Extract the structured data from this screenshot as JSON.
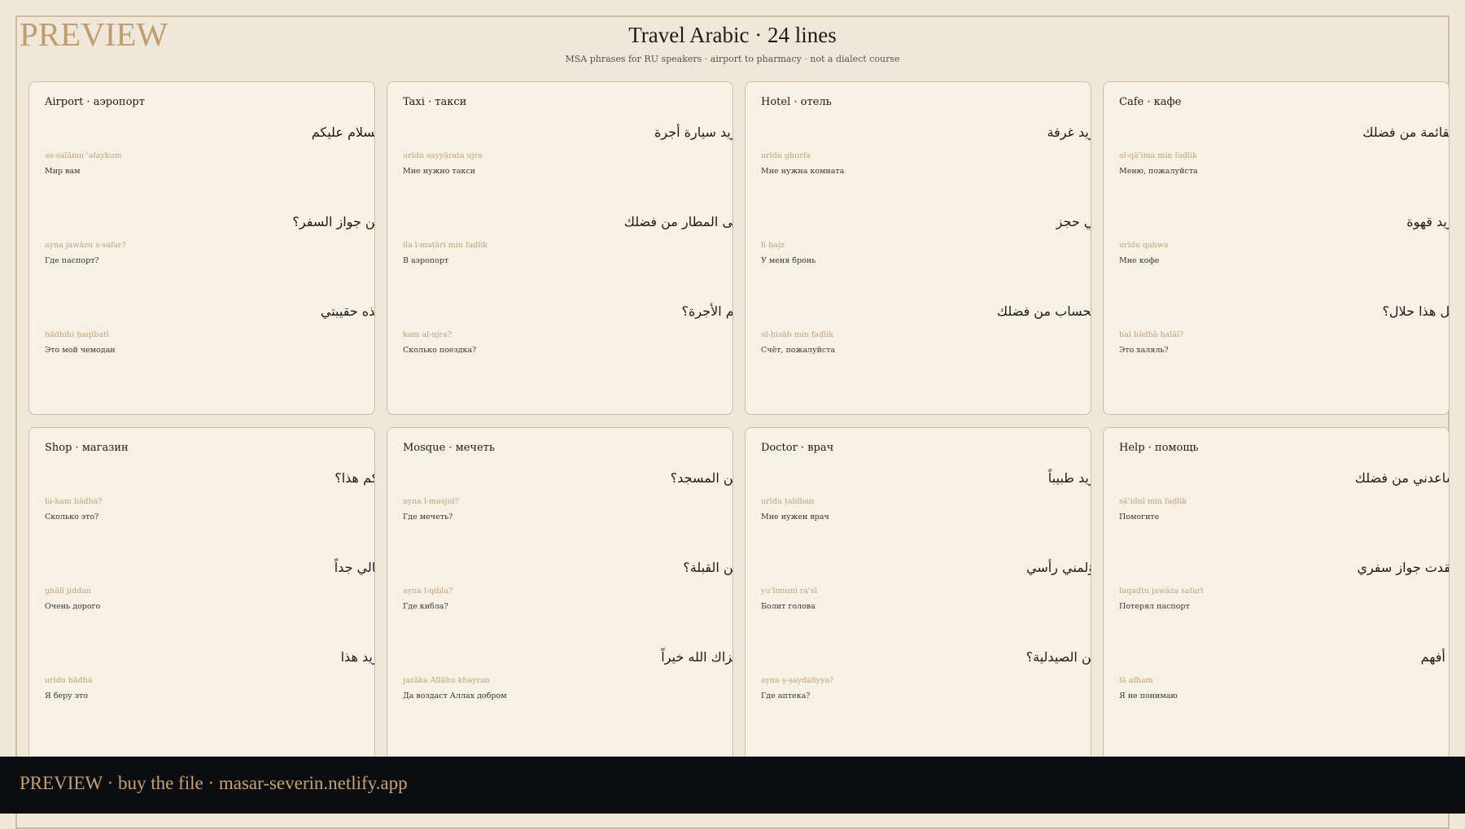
{
  "watermark": "PREVIEW",
  "title": "Travel Arabic · 24 lines",
  "subtitle": "MSA phrases for RU speakers · airport to pharmacy · not a dialect course",
  "cards": [
    {
      "title": "Airport · аэропорт",
      "phrases": [
        {
          "arabic": "السلام عليكم",
          "translit": "as-salāmu ʿalaykum",
          "russian": "Мир вам"
        },
        {
          "arabic": "أين جواز السفر؟",
          "translit": "ayna jawāzu s-safar?",
          "russian": "Где паспорт?"
        },
        {
          "arabic": "هذه حقيبتي",
          "translit": "hādhihi ḥaqībatī",
          "russian": "Это мой чемодан"
        }
      ]
    },
    {
      "title": "Taxi · такси",
      "phrases": [
        {
          "arabic": "أريد سيارة أجرة",
          "translit": "urīdu sayyārata ujra",
          "russian": "Мне нужно такси"
        },
        {
          "arabic": "إلى المطار من فضلك",
          "translit": "ila l-maṭāri min faḍlik",
          "russian": "В аэропорт"
        },
        {
          "arabic": "كم الأجرة؟",
          "translit": "kam al-ujra?",
          "russian": "Сколько поездка?"
        }
      ]
    },
    {
      "title": "Hotel · отель",
      "phrases": [
        {
          "arabic": "أريد غرفة",
          "translit": "urīdu ghurfa",
          "russian": "Мне нужна комната"
        },
        {
          "arabic": "لي حجز",
          "translit": "lī ḥajz",
          "russian": "У меня бронь"
        },
        {
          "arabic": "الحساب من فضلك",
          "translit": "al-ḥisāb min faḍlik",
          "russian": "Счёт, пожалуйста"
        }
      ]
    },
    {
      "title": "Cafe · кафе",
      "phrases": [
        {
          "arabic": "القائمة من فضلك",
          "translit": "al-qāʾima min faḍlik",
          "russian": "Меню, пожалуйста"
        },
        {
          "arabic": "أريد قهوة",
          "translit": "urīdu qahwa",
          "russian": "Мне кофе"
        },
        {
          "arabic": "هل هذا حلال؟",
          "translit": "hal hādhā ḥalāl?",
          "russian": "Это халяль?"
        }
      ]
    },
    {
      "title": "Shop · магазин",
      "phrases": [
        {
          "arabic": "بكم هذا؟",
          "translit": "bi-kam hādhā?",
          "russian": "Сколько это?"
        },
        {
          "arabic": "غالي جداً",
          "translit": "ghālī jiddan",
          "russian": "Очень дорого"
        },
        {
          "arabic": "أريد هذا",
          "translit": "urīdu hādhā",
          "russian": "Я беру это"
        }
      ]
    },
    {
      "title": "Mosque · мечеть",
      "phrases": [
        {
          "arabic": "أين المسجد؟",
          "translit": "ayna l-masjid?",
          "russian": "Где мечеть?"
        },
        {
          "arabic": "أين القبلة؟",
          "translit": "ayna l-qibla?",
          "russian": "Где кибла?"
        },
        {
          "arabic": "جزاك الله خيراً",
          "translit": "jazāka Allāhu khayran",
          "russian": "Да воздаст Аллах добром"
        }
      ]
    },
    {
      "title": "Doctor · врач",
      "phrases": [
        {
          "arabic": "أريد طبيباً",
          "translit": "urīdu ṭabīban",
          "russian": "Мне нужен врач"
        },
        {
          "arabic": "يؤلمني رأسي",
          "translit": "yuʾlimunī raʾsī",
          "russian": "Болит голова"
        },
        {
          "arabic": "أين الصيدلية؟",
          "translit": "ayna ṣ-ṣaydaliyya?",
          "russian": "Где аптека?"
        }
      ]
    },
    {
      "title": "Help · помощь",
      "phrases": [
        {
          "arabic": "ساعدني من فضلك",
          "translit": "sāʿidnī min faḍlik",
          "russian": "Помогите"
        },
        {
          "arabic": "فقدت جواز سفري",
          "translit": "faqadtu jawāza safarī",
          "russian": "Потерял паспорт"
        },
        {
          "arabic": "لا أفهم",
          "translit": "lā afham",
          "russian": "Я не понимаю"
        }
      ]
    }
  ],
  "footer": {
    "text": "PREVIEW  ·  buy the file  ·  masar-severin.netlify.app"
  }
}
